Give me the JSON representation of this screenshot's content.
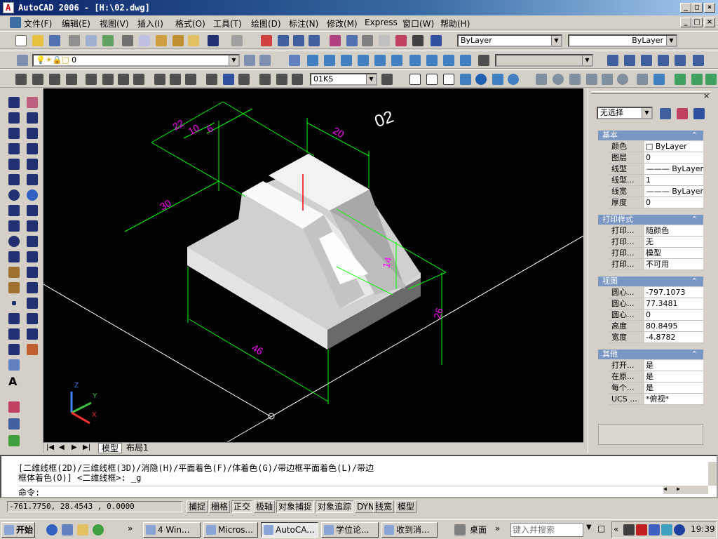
{
  "window": {
    "title": "AutoCAD 2006 - [H:\\02.dwg]",
    "min": "_",
    "max": "□",
    "close": "×"
  },
  "menu": [
    "文件(F)",
    "编辑(E)",
    "视图(V)",
    "插入(I)",
    "格式(O)",
    "工具(T)",
    "绘图(D)",
    "标注(N)",
    "修改(M)",
    "Express",
    "窗口(W)",
    "帮助(H)"
  ],
  "toolbar": {
    "color_value": "ByLayer",
    "linetype_value": "ByLayer",
    "layer_value": "0",
    "dimstyle_value": "01KS"
  },
  "drawing": {
    "label": "02",
    "dims": [
      "22",
      "10",
      "6",
      "20",
      "30",
      "14",
      "26",
      "46"
    ]
  },
  "tabs": {
    "model": "模型",
    "layout1": "布局1"
  },
  "props": {
    "selector": "无选择",
    "sections": [
      {
        "title": "基本",
        "rows": [
          {
            "k": "颜色",
            "v": "ByLayer"
          },
          {
            "k": "图层",
            "v": "0"
          },
          {
            "k": "线型",
            "v": "ByLayer"
          },
          {
            "k": "线型...",
            "v": "1"
          },
          {
            "k": "线宽",
            "v": "ByLayer"
          },
          {
            "k": "厚度",
            "v": "0"
          }
        ]
      },
      {
        "title": "打印样式",
        "rows": [
          {
            "k": "打印...",
            "v": "随颜色"
          },
          {
            "k": "打印...",
            "v": "无"
          },
          {
            "k": "打印...",
            "v": "模型"
          },
          {
            "k": "打印...",
            "v": "不可用"
          }
        ]
      },
      {
        "title": "视图",
        "rows": [
          {
            "k": "圆心...",
            "v": "-797.1073"
          },
          {
            "k": "圆心...",
            "v": "77.3481"
          },
          {
            "k": "圆心...",
            "v": "0"
          },
          {
            "k": "高度",
            "v": "80.8495"
          },
          {
            "k": "宽度",
            "v": "-4.8782"
          }
        ]
      },
      {
        "title": "其他",
        "rows": [
          {
            "k": "打开...",
            "v": "是"
          },
          {
            "k": "在原...",
            "v": "是"
          },
          {
            "k": "每个...",
            "v": "是"
          },
          {
            "k": "UCS ...",
            "v": "*俯视*"
          }
        ]
      }
    ]
  },
  "command": {
    "line1": "[二维线框(2D)/三维线框(3D)/消隐(H)/平面着色(F)/体着色(G)/带边框平面着色(L)/带边",
    "line2": "框体着色(O)] <二维线框>: _g",
    "prompt": "命令:"
  },
  "status": {
    "coords": "-761.7750, 28.4543 , 0.0000",
    "buttons": [
      "捕捉",
      "栅格",
      "正交",
      "极轴",
      "对象捕捉",
      "对象追踪",
      "DYN",
      "线宽",
      "模型"
    ]
  },
  "taskbar": {
    "start": "开始",
    "items": [
      "4 Win...",
      "Micros...",
      "AutoCA...",
      "学位论...",
      "收到消..."
    ],
    "desktop": "桌面",
    "search_placeholder": "键入并搜索",
    "clock": "19:39"
  },
  "colors": {
    "title": "#0a246a",
    "dims": "#00ff00",
    "text_dim": "#ff00ff",
    "canvas": "#000000"
  }
}
